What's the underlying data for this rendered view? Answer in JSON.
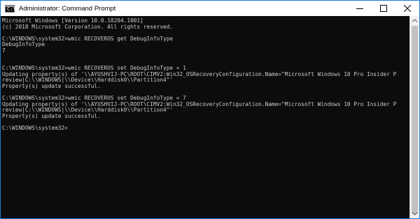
{
  "window": {
    "title": "Administrator: Command Prompt",
    "icon_text": "C:\\"
  },
  "console": {
    "lines": [
      "Microsoft Windows [Version 10.0.18204.1001]",
      "(c) 2018 Microsoft Corporation. All rights reserved.",
      "",
      "C:\\WINDOWS\\system32>wmic RECOVEROS get DebugInfoType",
      "DebugInfoType",
      "7",
      "",
      "",
      "C:\\WINDOWS\\system32>wmic RECOVEROS set DebugInfoType = 1",
      "Updating property(s) of '\\\\AYUSHVIJ-PC\\ROOT\\CIMV2:Win32_OSRecoveryConfiguration.Name=\"Microsoft Windows 10 Pro Insider P",
      "review|C:\\\\WINDOWS|\\\\Device\\\\Harddisk0\\\\Partition4\"'",
      "Property(s) update successful.",
      "",
      "C:\\WINDOWS\\system32>wmic RECOVEROS set DebugInfoType = 7",
      "Updating property(s) of '\\\\AYUSHVIJ-PC\\ROOT\\CIMV2:Win32_OSRecoveryConfiguration.Name=\"Microsoft Windows 10 Pro Insider P",
      "review|C:\\\\WINDOWS|\\\\Device\\\\Harddisk0\\\\Partition4\"'",
      "Property(s) update successful.",
      "",
      "C:\\WINDOWS\\system32>"
    ]
  },
  "colors": {
    "console_background": "#0c0c0c",
    "console_text": "#cccccc",
    "window_border": "#1e78d7"
  },
  "icons": {
    "app": "cmd-icon",
    "minimize": "minimize-icon",
    "maximize": "maximize-icon",
    "close": "close-icon",
    "scroll_up": "chevron-up-icon",
    "scroll_down": "chevron-down-icon"
  }
}
